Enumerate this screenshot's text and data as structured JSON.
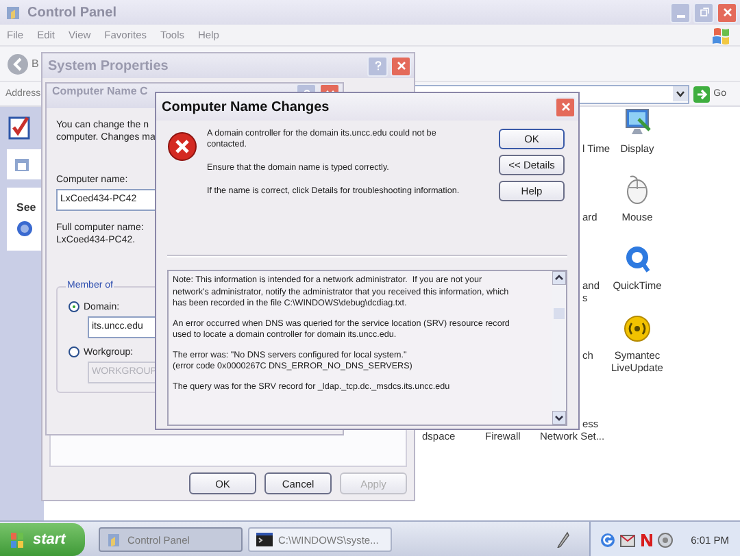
{
  "control_panel": {
    "title": "Control Panel",
    "menu": [
      "File",
      "Edit",
      "View",
      "Favorites",
      "Tools",
      "Help"
    ],
    "back_button": "B",
    "address_label": "Address",
    "go_button": "Go",
    "sidebar_heading": "See",
    "icons": [
      {
        "kind": "cut",
        "lines": [
          "l Time"
        ]
      },
      {
        "kind": "display",
        "lines": [
          "Display"
        ]
      },
      {
        "kind": "cut",
        "lines": [
          "ard"
        ]
      },
      {
        "kind": "mouse",
        "lines": [
          "Mouse"
        ]
      },
      {
        "kind": "cut",
        "lines": [
          "and",
          "s"
        ]
      },
      {
        "kind": "quicktime",
        "lines": [
          "QuickTime"
        ]
      },
      {
        "kind": "cut",
        "lines": [
          "ch"
        ]
      },
      {
        "kind": "symantec",
        "lines": [
          "Symantec",
          "LiveUpdate"
        ]
      },
      {
        "kind": "cut",
        "lines": [
          "ess"
        ]
      },
      {
        "kind": "cut",
        "lines": [
          "dspace"
        ]
      },
      {
        "kind": "cut",
        "lines": [
          "Firewall"
        ]
      },
      {
        "kind": "cut",
        "lines": [
          "Network Set..."
        ]
      }
    ]
  },
  "system_properties": {
    "title": "System Properties",
    "buttons": [
      {
        "label": "OK",
        "disabled": false
      },
      {
        "label": "Cancel",
        "disabled": false
      },
      {
        "label": "Apply",
        "disabled": true
      }
    ]
  },
  "name_dialog": {
    "title": "Computer Name C",
    "intro": [
      "You can change the n",
      "computer. Changes ma"
    ],
    "computer_name_label": "Computer name:",
    "computer_name": "LxCoed434-PC42",
    "full_name_label": "Full computer name:",
    "full_name": "LxCoed434-PC42.",
    "member_of": {
      "title": "Member of",
      "options": [
        {
          "label": "Domain:",
          "selected": true,
          "value": "its.uncc.edu"
        },
        {
          "label": "Workgroup:",
          "selected": false,
          "value": "WORKGROUP"
        }
      ]
    }
  },
  "error_dialog": {
    "title": "Computer Name Changes",
    "messages": [
      [
        "A domain controller for the domain its.uncc.edu could not be",
        "contacted."
      ],
      [
        "Ensure that the domain name is typed correctly."
      ],
      [
        "If the name is correct, click Details for troubleshooting information."
      ]
    ],
    "buttons": [
      {
        "label": "OK",
        "default": true
      },
      {
        "label": "<< Details",
        "default": false
      },
      {
        "label": "Help",
        "default": false
      }
    ],
    "details": [
      [
        "Note: This information is intended for a network administrator.  If you are not your",
        "network's administrator, notify the administrator that you received this information, which",
        "has been recorded in the file C:\\WINDOWS\\debug\\dcdiag.txt."
      ],
      [
        "An error occurred when DNS was queried for the service location (SRV) resource record",
        "used to locate a domain controller for domain its.uncc.edu."
      ],
      [
        "The error was: \"No DNS servers configured for local system.\"",
        "(error code 0x0000267C DNS_ERROR_NO_DNS_SERVERS)"
      ],
      [
        "The query was for the SRV record for _ldap._tcp.dc._msdcs.its.uncc.edu"
      ]
    ]
  },
  "taskbar": {
    "start": "start",
    "tasks": [
      {
        "label": "Control Panel",
        "selected": true
      },
      {
        "label": "C:\\WINDOWS\\syste...",
        "selected": false
      }
    ],
    "clock": "6:01 PM"
  }
}
